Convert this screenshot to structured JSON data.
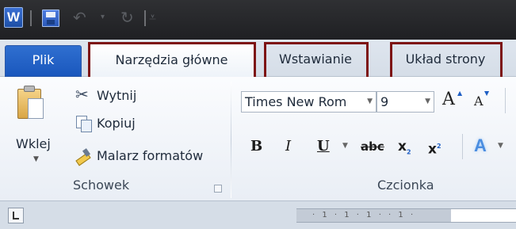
{
  "quick_access": {
    "app_icon_letter": "W",
    "icons": [
      "word-app-icon",
      "save-icon",
      "undo-icon",
      "redo-icon",
      "customize-icon"
    ]
  },
  "tabs": {
    "file": "Plik",
    "home": "Narzędzia główne",
    "insert": "Wstawianie",
    "layout": "Układ strony"
  },
  "clipboard": {
    "paste": "Wklej",
    "cut": "Wytnij",
    "copy": "Kopiuj",
    "format_painter": "Malarz formatów",
    "group_label": "Schowek"
  },
  "font": {
    "font_name": "Times New Rom",
    "font_size": "9",
    "grow": "A",
    "shrink": "A",
    "bold": "B",
    "italic": "I",
    "underline": "U",
    "strike": "abc",
    "subscript": "x",
    "superscript": "x",
    "text_effects": "A",
    "group_label": "Czcionka"
  },
  "ruler": {
    "marks": "· 1 · 1 · 1 ·    · 1 ·"
  },
  "colors": {
    "file_tab": "#1a57bd",
    "highlight_border": "#7d1414"
  }
}
